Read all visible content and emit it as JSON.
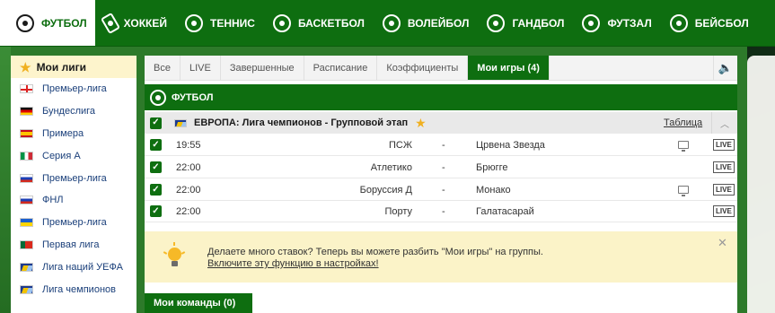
{
  "sports": [
    {
      "label": "ФУТБОЛ",
      "icon": "soccer-ball-icon",
      "active": true
    },
    {
      "label": "ХОККЕЙ",
      "icon": "hockey-icon",
      "active": false
    },
    {
      "label": "ТЕННИС",
      "icon": "tennis-ball-icon",
      "active": false
    },
    {
      "label": "БАСКЕТБОЛ",
      "icon": "basketball-icon",
      "active": false
    },
    {
      "label": "ВОЛЕЙБОЛ",
      "icon": "volleyball-icon",
      "active": false
    },
    {
      "label": "ГАНДБОЛ",
      "icon": "handball-icon",
      "active": false
    },
    {
      "label": "ФУТЗАЛ",
      "icon": "futsal-icon",
      "active": false
    },
    {
      "label": "БЕЙСБОЛ",
      "icon": "baseball-icon",
      "active": false
    }
  ],
  "sidebar": {
    "title": "Мои лиги",
    "items": [
      {
        "label": "Премьер-лига",
        "flag": "england"
      },
      {
        "label": "Бундеслига",
        "flag": "germany"
      },
      {
        "label": "Примера",
        "flag": "spain"
      },
      {
        "label": "Серия А",
        "flag": "italy"
      },
      {
        "label": "Премьер-лига",
        "flag": "russia"
      },
      {
        "label": "ФНЛ",
        "flag": "russia"
      },
      {
        "label": "Премьер-лига",
        "flag": "ukraine"
      },
      {
        "label": "Первая лига",
        "flag": "portugal"
      },
      {
        "label": "Лига наций УЕФА",
        "flag": "europe"
      },
      {
        "label": "Лига чемпионов",
        "flag": "europe"
      }
    ]
  },
  "tabs": [
    {
      "label": "Все",
      "active": false
    },
    {
      "label": "LIVE",
      "active": false
    },
    {
      "label": "Завершенные",
      "active": false
    },
    {
      "label": "Расписание",
      "active": false
    },
    {
      "label": "Коэффициенты",
      "active": false
    },
    {
      "label": "Мои игры (4)",
      "active": true
    }
  ],
  "section": {
    "title": "ФУТБОЛ"
  },
  "league": {
    "title": "ЕВРОПА: Лига чемпионов - Групповой этап",
    "table_link": "Таблица"
  },
  "matches": [
    {
      "time": "19:55",
      "home": "ПСЖ",
      "dash": "-",
      "away": "Црвена Звезда",
      "tv": true,
      "live": "LIVE"
    },
    {
      "time": "22:00",
      "home": "Атлетико",
      "dash": "-",
      "away": "Брюгге",
      "tv": false,
      "live": "LIVE"
    },
    {
      "time": "22:00",
      "home": "Боруссия Д",
      "dash": "-",
      "away": "Монако",
      "tv": true,
      "live": "LIVE"
    },
    {
      "time": "22:00",
      "home": "Порту",
      "dash": "-",
      "away": "Галатасарай",
      "tv": false,
      "live": "LIVE"
    }
  ],
  "notice": {
    "line1": "Делаете много ставок? Теперь вы можете разбить \"Мои игры\" на группы.",
    "line2": "Включите эту функцию в настройках!",
    "close": "✕"
  },
  "my_teams": {
    "label": "Мои команды (0)"
  },
  "colors": {
    "brand_green": "#0e6e10",
    "notice_bg": "#fbf3c8",
    "sidebar_head_bg": "#fdf4cc"
  }
}
